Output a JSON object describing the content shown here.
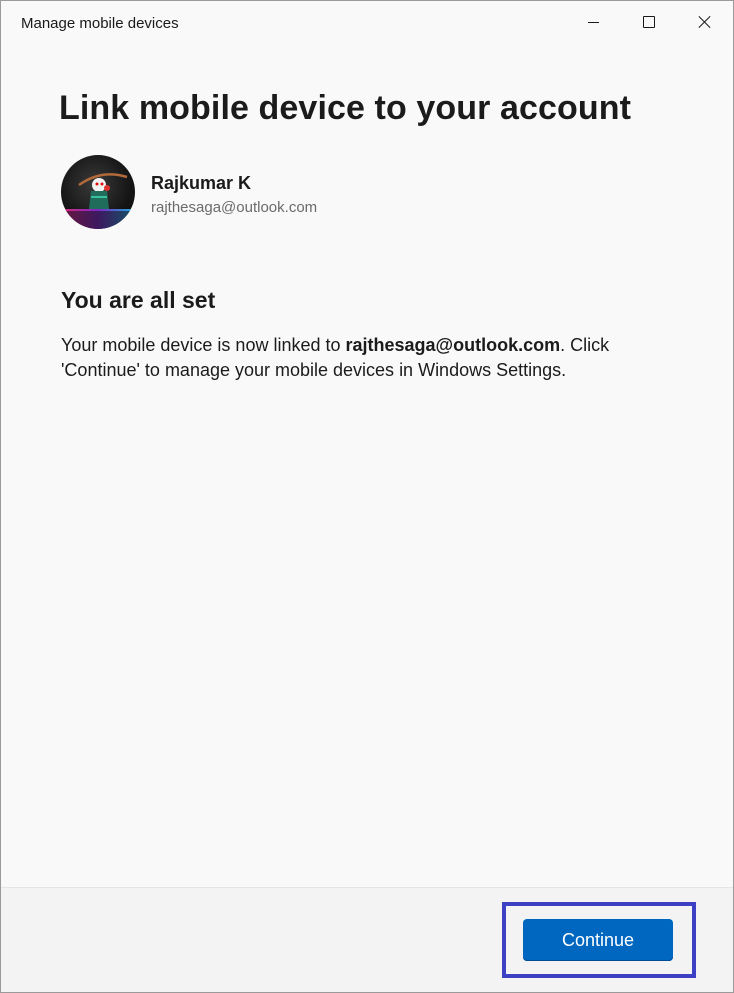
{
  "window": {
    "title": "Manage mobile devices"
  },
  "caption_buttons": {
    "minimize": "minimize-icon",
    "maximize": "maximize-icon",
    "close": "close-icon"
  },
  "page": {
    "heading": "Link mobile device to your account"
  },
  "account": {
    "name": "Rajkumar K",
    "email": "rajthesaga@outlook.com"
  },
  "status": {
    "heading": "You are all set",
    "message_prefix": "Your mobile device is now linked to ",
    "message_email": "rajthesaga@outlook.com",
    "message_suffix": ". Click 'Continue' to manage your mobile devices in Windows Settings."
  },
  "footer": {
    "continue_label": "Continue"
  },
  "colors": {
    "accent": "#0067c0",
    "highlight_border": "#3d3fc4",
    "background": "#f9f9f9",
    "footer_background": "#f3f3f3"
  }
}
